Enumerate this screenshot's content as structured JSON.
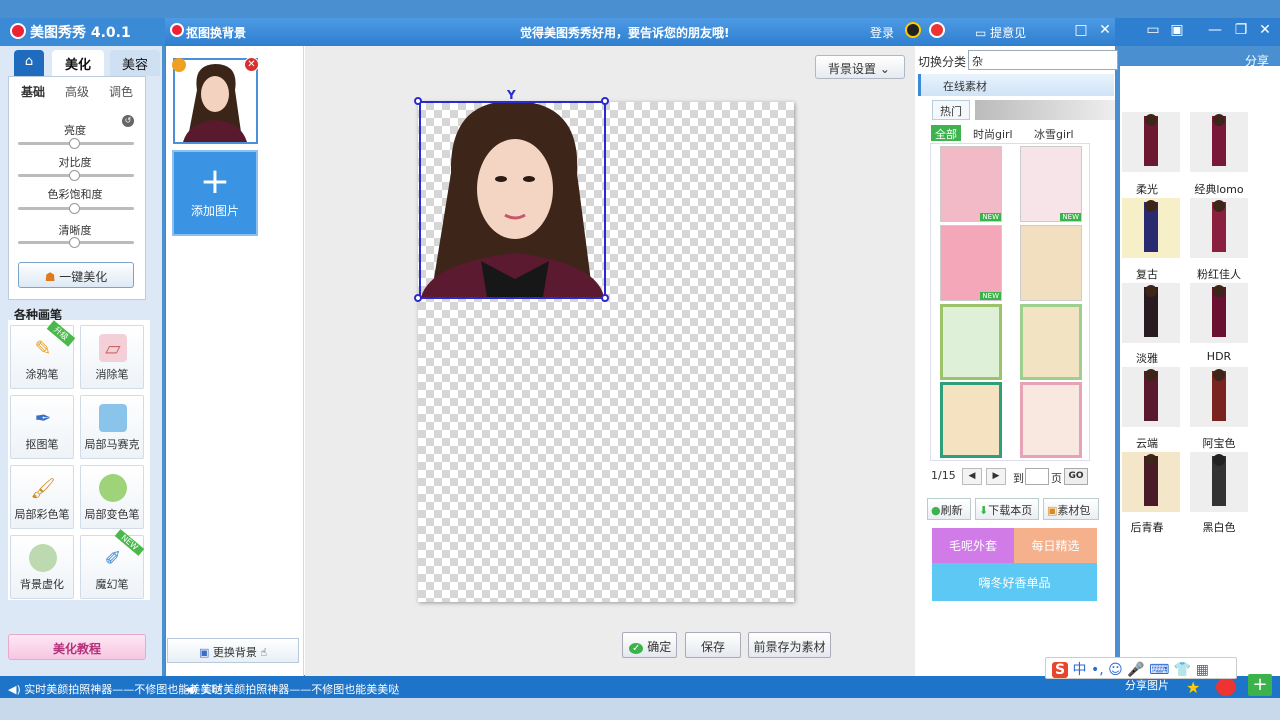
{
  "app": {
    "title": "美图秀秀 4.0.1"
  },
  "nav": {
    "tab_beautify": "美化",
    "tab_face": "美容"
  },
  "basic": {
    "tabs": [
      "基础",
      "高级",
      "调色"
    ],
    "sliders": [
      {
        "label": "亮度",
        "value": 0.5
      },
      {
        "label": "对比度",
        "value": 0.5
      },
      {
        "label": "色彩饱和度",
        "value": 0.5
      },
      {
        "label": "清晰度",
        "value": 0.5
      }
    ],
    "one_key": "一键美化"
  },
  "brushes": {
    "title": "各种画笔",
    "items": [
      {
        "label": "涂鸦笔",
        "icon": "crayon-icon"
      },
      {
        "label": "消除笔",
        "icon": "eraser-icon"
      },
      {
        "label": "抠图笔",
        "icon": "cutout-pen-icon"
      },
      {
        "label": "局部马赛克",
        "icon": "mosaic-icon"
      },
      {
        "label": "局部彩色笔",
        "icon": "color-brush-icon"
      },
      {
        "label": "局部变色笔",
        "icon": "paint-bucket-icon"
      },
      {
        "label": "背景虚化",
        "icon": "blur-icon"
      },
      {
        "label": "魔幻笔",
        "icon": "magic-pen-icon"
      }
    ],
    "ribbon_upgrade": "升级",
    "ribbon_new": "NEW"
  },
  "tutorial": "美化教程",
  "status": {
    "text": "实时美颜拍照神器——不修图也能美美哒"
  },
  "dialog": {
    "title": "抠图换背景",
    "slogan": "觉得美图秀秀好用，要告诉您的朋友哦!",
    "login": "登录",
    "feedback": "提意见",
    "add_image": "添加图片",
    "change_bg": "更换背景",
    "bg_settings": "背景设置",
    "ok": "确定",
    "save": "保存",
    "save_as_material": "前景存为素材"
  },
  "materials": {
    "switch_label": "切换分类",
    "switch_value": "杂",
    "online_tab": "在线素材",
    "hot_tab": "热门",
    "categories": [
      "全部",
      "时尚girl",
      "冰雪girl"
    ],
    "new_tag": "NEW",
    "page": "1/15",
    "goto_label": "到",
    "page_suffix": "页",
    "go": "GO",
    "refresh": "刷新",
    "download_page": "下载本页",
    "material_pack": "素材包",
    "banner": {
      "line1": "毛呢外套",
      "line2": "每日精选",
      "line3": "嗨冬好香单品"
    }
  },
  "effects": {
    "share_top": "分享",
    "items": [
      "柔光",
      "经典lomo",
      "复古",
      "粉红佳人",
      "淡雅",
      "HDR",
      "云端",
      "阿宝色",
      "后青春",
      "黑白色"
    ],
    "share_pic": "分享图片"
  },
  "ime": {
    "text": "中"
  },
  "colors": {
    "accent": "#3b8ad6",
    "selection": "#2a2ad0",
    "status_bar": "#1e74c8"
  }
}
